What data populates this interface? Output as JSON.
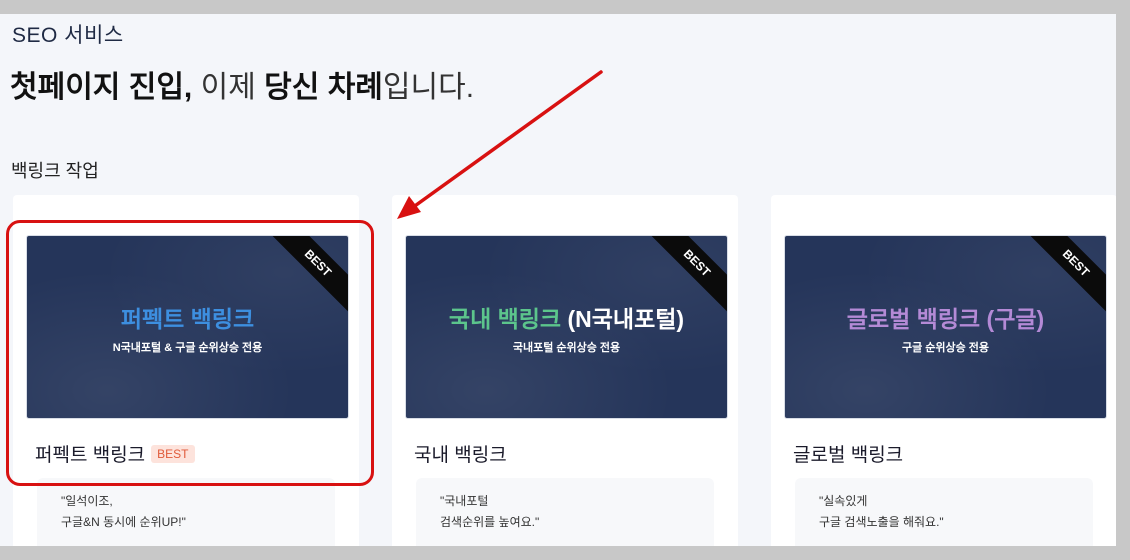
{
  "header": {
    "section_label": "SEO 서비스",
    "headline": {
      "part1": "첫페이지 진입,",
      "part2": " 이제 ",
      "part3": "당신 차례",
      "part4": "입니다."
    },
    "sub_label": "백링크 작업"
  },
  "cards": [
    {
      "banner_title": "퍼펙트 백링크",
      "banner_title_color": "#3d8fe0",
      "banner_subtitle": "N국내포털 & 구글 순위상승 전용",
      "ribbon": "BEST",
      "title": "퍼펙트 백링크",
      "badge": "BEST",
      "quote": "\"일석이조,\n구글&N 동시에 순위UP!\""
    },
    {
      "banner_title_part1": "국내 백링크",
      "banner_title_part2": " (N국내포털)",
      "banner_title_color": "#5cc58c",
      "banner_subtitle": "국내포털 순위상승 전용",
      "ribbon": "BEST",
      "title": "국내 백링크",
      "quote": "\"국내포털\n검색순위를 높여요.\""
    },
    {
      "banner_title": "글로벌 백링크 (구글)",
      "banner_title_color": "#b48ad6",
      "banner_subtitle": "구글 순위상승 전용",
      "ribbon": "BEST",
      "title": "글로벌 백링크",
      "quote": "\"실속있게\n구글 검색노출을 해줘요.\""
    }
  ],
  "annotations": {
    "highlight_color": "#d81111",
    "arrow_color": "#d81111"
  }
}
